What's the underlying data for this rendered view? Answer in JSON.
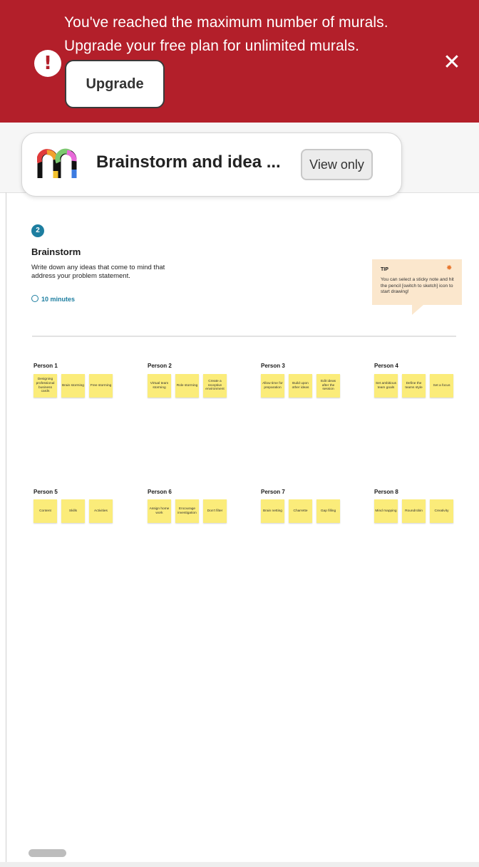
{
  "banner": {
    "line1": "You've reached the maximum number of murals.",
    "line2": "Upgrade your free plan for unlimited murals.",
    "upgrade_label": "Upgrade",
    "close_icon": "close-icon",
    "alert_icon": "exclamation-icon",
    "bg_color": "#b31f2a"
  },
  "header": {
    "title": "Brainstorm and idea ...",
    "view_only_label": "View only"
  },
  "section": {
    "step": "2",
    "title": "Brainstorm",
    "description": "Write down any ideas that come to mind that address your problem statement.",
    "timer": "10 minutes"
  },
  "tip": {
    "label": "TIP",
    "text": "You can select a sticky note and hit the pencil [switch to sketch] icon to start drawing!"
  },
  "people": [
    {
      "name": "Person 1",
      "notes": [
        "Designing professional business cards",
        "Brain storming",
        "Free storming"
      ]
    },
    {
      "name": "Person 2",
      "notes": [
        "Virtual team storming",
        "Role storming",
        "Create a receptive environment"
      ]
    },
    {
      "name": "Person 3",
      "notes": [
        "Allow time for preparation",
        "Build upon other ideas",
        "Edit ideas after the session"
      ]
    },
    {
      "name": "Person 4",
      "notes": [
        "Set ambitious team goals",
        "Define the teams style",
        "Set a focus"
      ]
    },
    {
      "name": "Person 5",
      "notes": [
        "Content",
        "Skills",
        "Activities"
      ]
    },
    {
      "name": "Person 6",
      "notes": [
        "Assign home work",
        "Encourage investigation",
        "Don't filter"
      ]
    },
    {
      "name": "Person 7",
      "notes": [
        "Brain netting",
        "Charrette",
        "Gap filling"
      ]
    },
    {
      "name": "Person 8",
      "notes": [
        "Mind mapping",
        "Roundrobin",
        "Creativity"
      ]
    }
  ]
}
